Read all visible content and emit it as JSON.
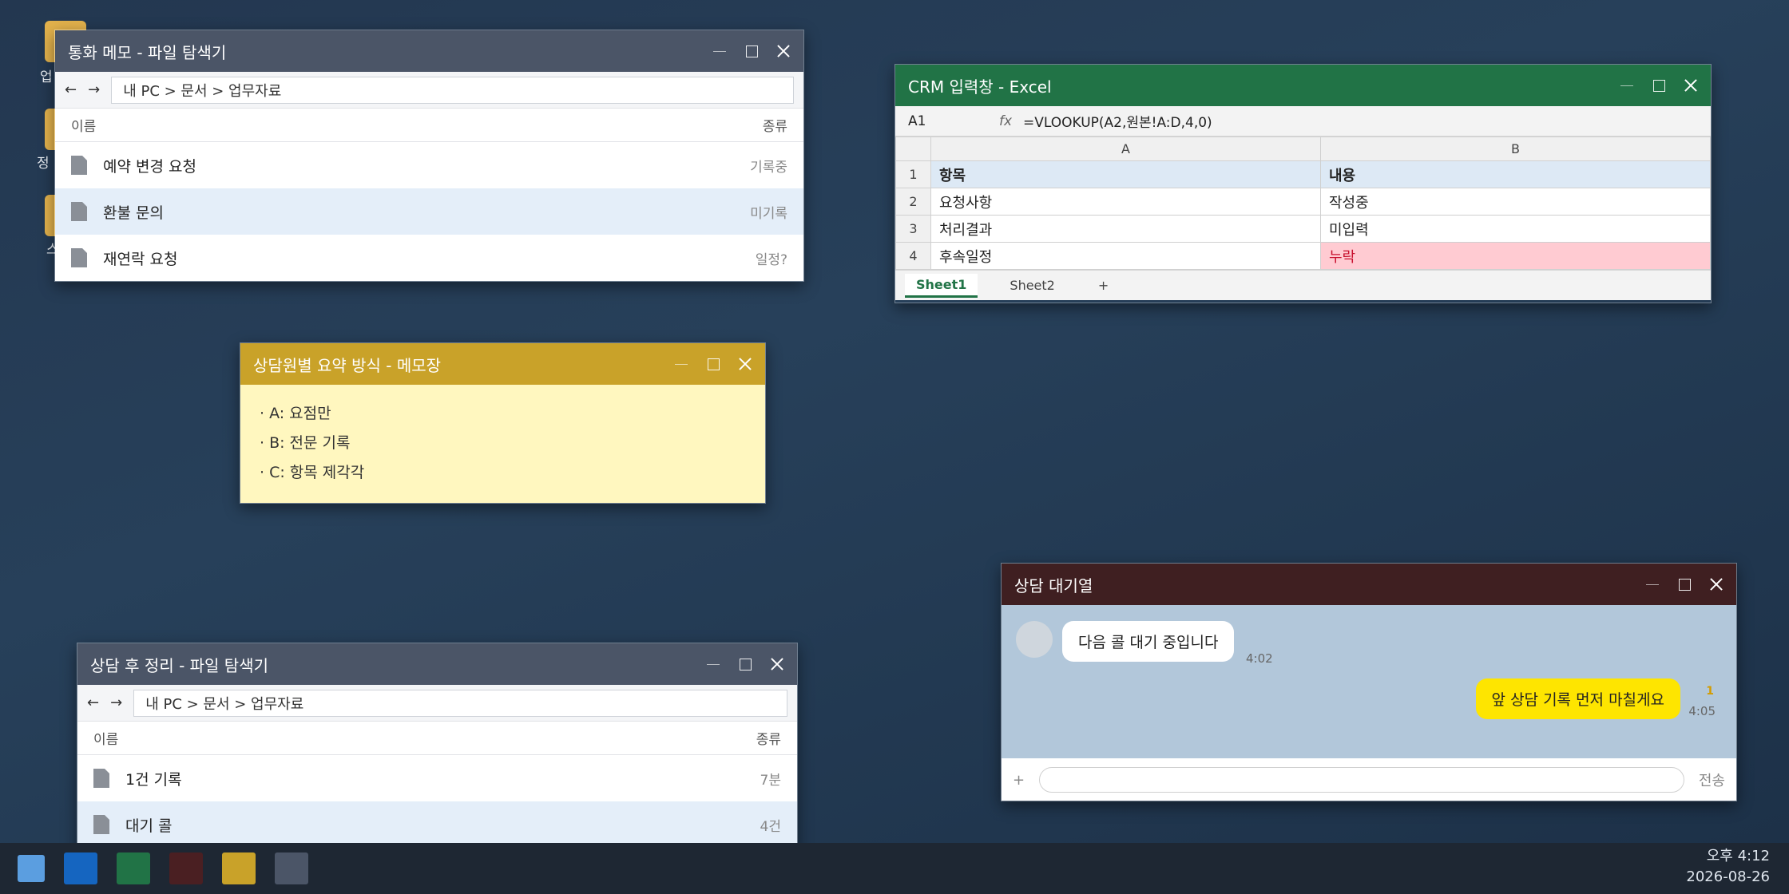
{
  "desktop": {
    "icons": [
      {
        "label": "업"
      },
      {
        "label": "정"
      },
      {
        "label": "스"
      }
    ]
  },
  "explorer1": {
    "title": "통화 메모 - 파일 탐색기",
    "back": "←",
    "forward": "→",
    "path": "내 PC > 문서 > 업무자료",
    "col_name": "이름",
    "col_type": "종류",
    "files": [
      {
        "name": "예약 변경 요청",
        "type": "기록중"
      },
      {
        "name": "환불 문의",
        "type": "미기록"
      },
      {
        "name": "재연락 요청",
        "type": "일정?"
      }
    ]
  },
  "memo": {
    "title": "상담원별 요약 방식 - 메모장",
    "lines": [
      "· A: 요점만",
      "· B: 전문 기록",
      "· C: 항목 제각각"
    ]
  },
  "excel": {
    "title": "CRM 입력창 - Excel",
    "cell_ref": "A1",
    "fx": "fx",
    "formula": "=VLOOKUP(A2,원본!A:D,4,0)",
    "col_a": "A",
    "col_b": "B",
    "rows": [
      {
        "n": "1",
        "a": "항목",
        "b": "내용"
      },
      {
        "n": "2",
        "a": "요청사항",
        "b": "작성중"
      },
      {
        "n": "3",
        "a": "처리결과",
        "b": "미입력"
      },
      {
        "n": "4",
        "a": "후속일정",
        "b": "누락"
      }
    ],
    "sheets": [
      "Sheet1",
      "Sheet2"
    ],
    "add_sheet": "+",
    "missing_color": "#ffcbd2"
  },
  "chat": {
    "title": "상담 대기열",
    "incoming": "다음 콜 대기 중입니다",
    "incoming_time": "4:02",
    "outgoing": "앞 상담 기록 먼저 마칠게요",
    "outgoing_time": "4:05",
    "unread": "1",
    "plus": "+",
    "send": "전송"
  },
  "explorer2": {
    "title": "상담 후 정리 - 파일 탐색기",
    "back": "←",
    "forward": "→",
    "path": "내 PC > 문서 > 업무자료",
    "col_name": "이름",
    "col_type": "종류",
    "files": [
      {
        "name": "1건 기록",
        "type": "7분"
      },
      {
        "name": "대기 콜",
        "type": "4건"
      }
    ]
  },
  "taskbar": {
    "apps": [
      {
        "name": "explorer",
        "color": "#1565c0"
      },
      {
        "name": "excel",
        "color": "#217346"
      },
      {
        "name": "chat",
        "color": "#4a1f22"
      },
      {
        "name": "memo",
        "color": "#c9a229"
      },
      {
        "name": "explorer2",
        "color": "#4b5567"
      }
    ],
    "time": "오후 4:12",
    "date": "2026-08-26"
  }
}
